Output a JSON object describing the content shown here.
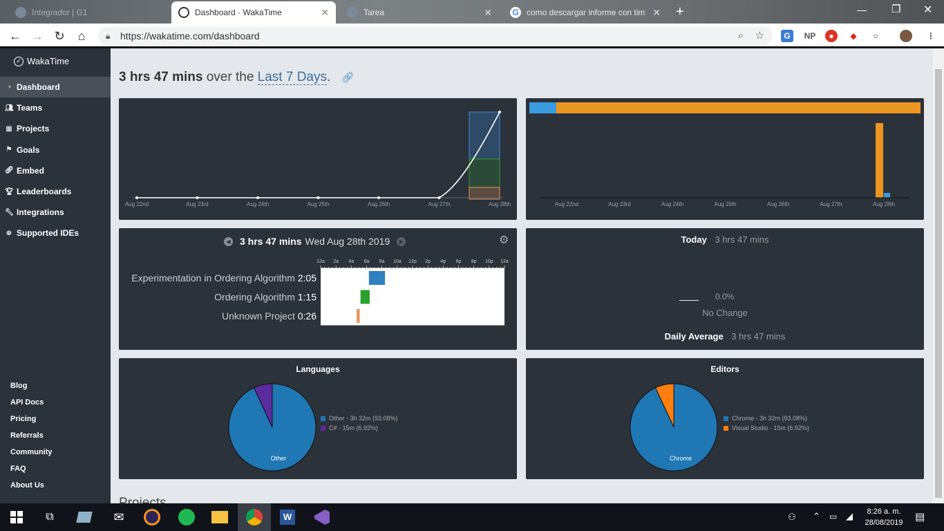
{
  "browser": {
    "tabs": [
      {
        "title": "Integrador | G1",
        "active": false
      },
      {
        "title": "Dashboard · WakaTime",
        "active": true
      },
      {
        "title": "Tarea",
        "active": false
      },
      {
        "title": "como descargar informe con tim",
        "active": false
      }
    ],
    "new_tab_label": "+",
    "url": "https://wakatime.com/dashboard",
    "ext_np": "NP"
  },
  "sidebar": {
    "brand": "WakaTime",
    "items": [
      {
        "label": "Dashboard",
        "icon": "dashboard-icon",
        "active": true
      },
      {
        "label": "Teams",
        "icon": "users-icon",
        "active": false
      },
      {
        "label": "Projects",
        "icon": "grid-icon",
        "active": false
      },
      {
        "label": "Goals",
        "icon": "flag-icon",
        "active": false
      },
      {
        "label": "Embed",
        "icon": "link-icon",
        "active": false
      },
      {
        "label": "Leaderboards",
        "icon": "trophy-icon",
        "active": false
      },
      {
        "label": "Integrations",
        "icon": "wrench-icon",
        "active": false
      },
      {
        "label": "Supported IDEs",
        "icon": "plus-circle-icon",
        "active": false
      }
    ],
    "footer": [
      "Blog",
      "API Docs",
      "Pricing",
      "Referrals",
      "Community",
      "FAQ",
      "About Us"
    ]
  },
  "header": {
    "total": "3 hrs 47 mins",
    "over_the": "over the",
    "range": "Last 7 Days",
    "period": "."
  },
  "activity_chart": {
    "dates": [
      "Aug 22nd",
      "Aug 23rd",
      "Aug 24th",
      "Aug 25th",
      "Aug 26th",
      "Aug 27th",
      "Aug 28th"
    ]
  },
  "language_bar_chart": {
    "dates": [
      "Aug 22nd",
      "Aug 23rd",
      "Aug 24th",
      "Aug 25th",
      "Aug 26th",
      "Aug 27th",
      "Aug 28th"
    ]
  },
  "day_panel": {
    "total": "3 hrs 47 mins",
    "date": "Wed Aug 28th 2019",
    "hours": [
      "12a",
      "2a",
      "4a",
      "6a",
      "8a",
      "10a",
      "12p",
      "2p",
      "4p",
      "6p",
      "8p",
      "10p",
      "12a"
    ],
    "projects": [
      {
        "name": "Experimentation in Ordering Algorithm",
        "time": "2:05",
        "color": "#2f7fc1",
        "start_hour": 6.3,
        "end_hour": 8.4
      },
      {
        "name": "Ordering Algorithm",
        "time": "1:15",
        "color": "#2ca02c",
        "start_hour": 5.2,
        "end_hour": 6.4
      },
      {
        "name": "Unknown Project",
        "time": "0:26",
        "color": "#e5975f",
        "start_hour": 4.7,
        "end_hour": 5.1
      }
    ]
  },
  "summary_panel": {
    "today_label": "Today",
    "today_value": "3 hrs 47 mins",
    "change_percent": "0.0%",
    "change_label": "No Change",
    "avg_label": "Daily Average",
    "avg_value": "3 hrs 47 mins"
  },
  "languages": {
    "title": "Languages",
    "slice_label": "Other",
    "legend": [
      {
        "label": "Other - 3h 32m (93.08%)",
        "color": "#1f77b4",
        "pct": 93.08
      },
      {
        "label": "C# - 15m (6.92%)",
        "color": "#5b2c9e",
        "pct": 6.92
      }
    ]
  },
  "editors": {
    "title": "Editors",
    "slice_label": "Chrome",
    "legend": [
      {
        "label": "Chrome - 3h 32m (93.08%)",
        "color": "#1f77b4",
        "pct": 93.08
      },
      {
        "label": "Visual Studio - 15m (6.92%)",
        "color": "#ff7f0e",
        "pct": 6.92
      }
    ]
  },
  "partial_heading": "Projects",
  "taskbar": {
    "time": "8:26 a. m.",
    "date": "28/08/2019"
  }
}
